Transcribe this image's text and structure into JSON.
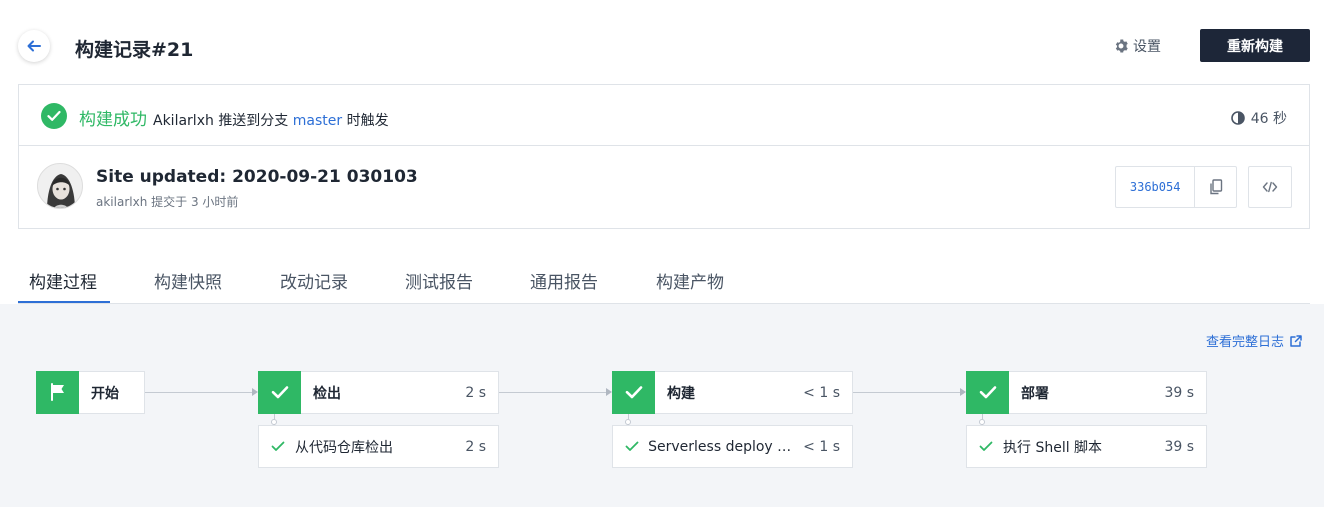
{
  "header": {
    "title": "构建记录#21",
    "settings_label": "设置",
    "rebuild_label": "重新构建"
  },
  "status": {
    "state": "构建成功",
    "author": "Akilarlxh",
    "pushed_to": "推送到分支",
    "branch": "master",
    "trigger": "时触发",
    "duration": "46 秒"
  },
  "commit": {
    "message": "Site updated: 2020-09-21 030103",
    "author": "akilarlxh",
    "submitted": "提交于 3 小时前",
    "hash": "336b054"
  },
  "tabs": [
    {
      "label": "构建过程",
      "active": true
    },
    {
      "label": "构建快照",
      "active": false
    },
    {
      "label": "改动记录",
      "active": false
    },
    {
      "label": "测试报告",
      "active": false
    },
    {
      "label": "通用报告",
      "active": false
    },
    {
      "label": "构建产物",
      "active": false
    }
  ],
  "pipeline": {
    "full_log_label": "查看完整日志",
    "stages": [
      {
        "name": "开始",
        "time": ""
      },
      {
        "name": "检出",
        "time": "2 s"
      },
      {
        "name": "构建",
        "time": "< 1 s"
      },
      {
        "name": "部署",
        "time": "39 s"
      }
    ],
    "steps": [
      {
        "name": "从代码仓库检出",
        "time": "2 s"
      },
      {
        "name": "Serverless deploy We...",
        "time": "< 1 s"
      },
      {
        "name": "执行 Shell 脚本",
        "time": "39 s"
      }
    ]
  },
  "colors": {
    "success": "#2fb865",
    "accent": "#2d6fd6",
    "primary_button": "#1d2638"
  },
  "icons": [
    "back-arrow-icon",
    "gear-icon",
    "check-circle-icon",
    "clock-icon",
    "copy-icon",
    "code-icon",
    "external-link-icon",
    "flag-icon",
    "check-icon"
  ]
}
